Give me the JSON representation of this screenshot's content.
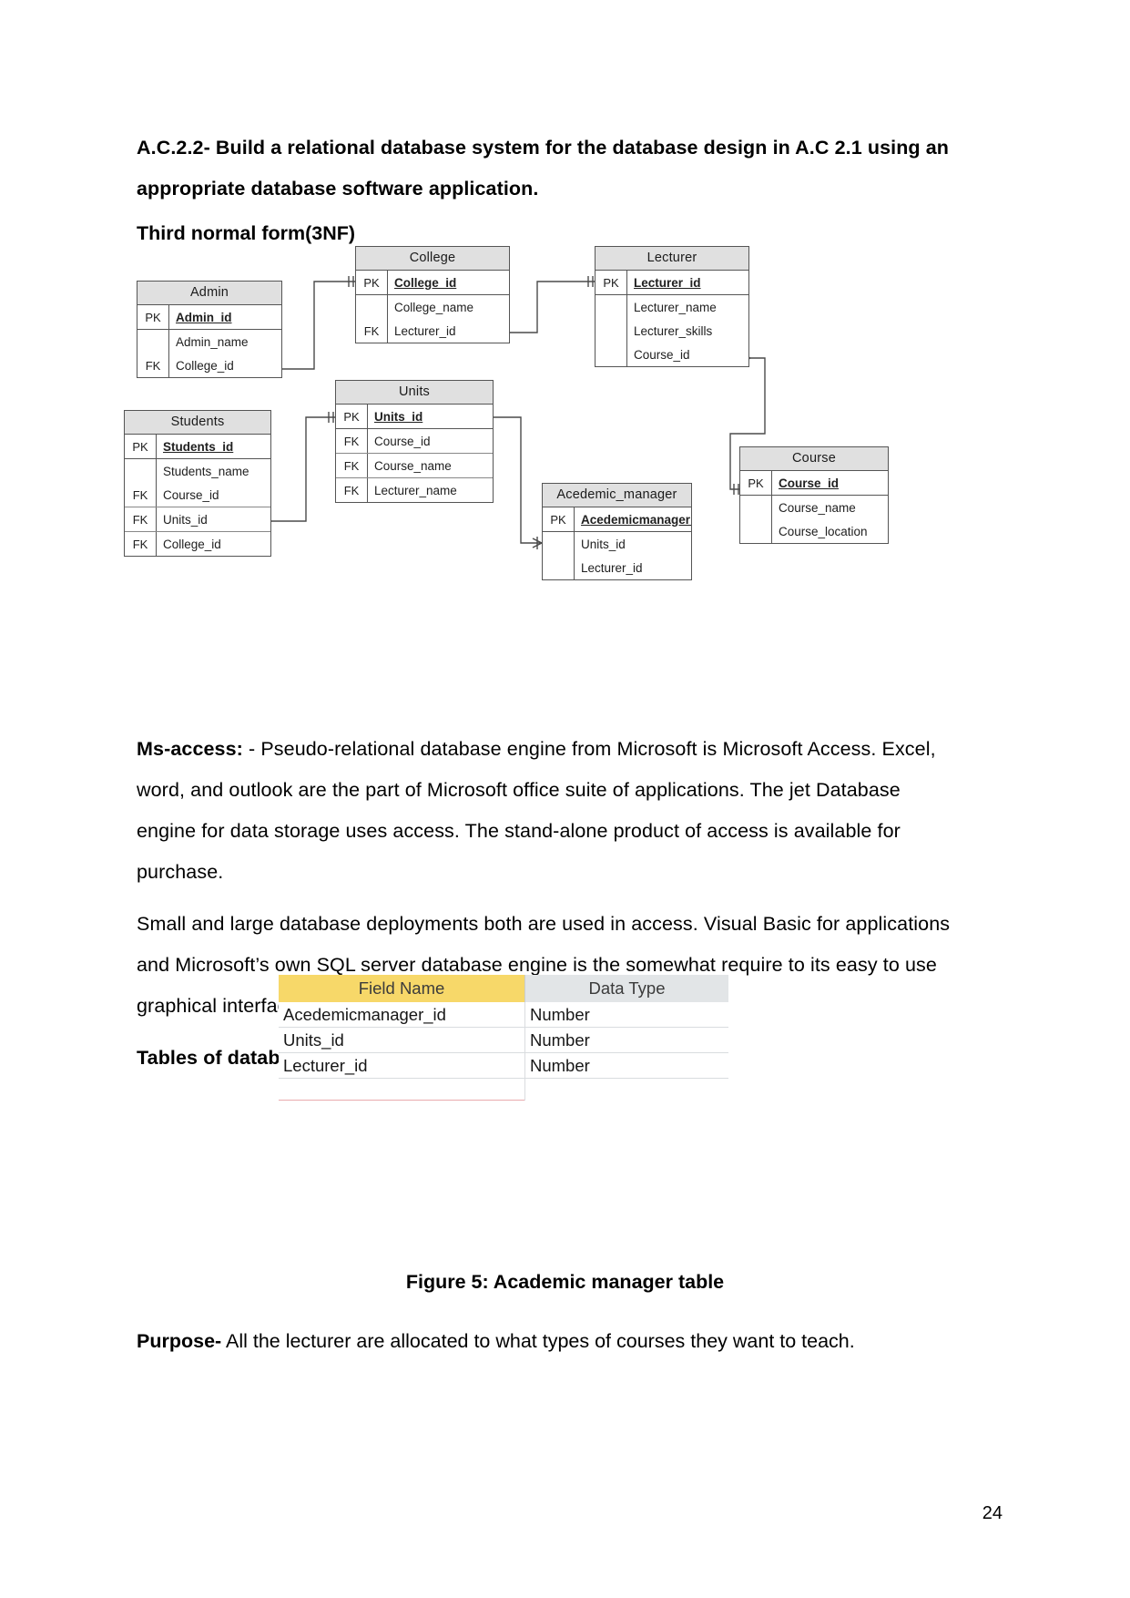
{
  "document": {
    "heading": "A.C.2.2- Build a relational database system for the database design in A.C 2.1 using an appropriate database software application.",
    "subheading": "Third normal form(3NF)",
    "page_number": "24"
  },
  "paragraphs": {
    "ms_access_lead": "Ms-access:",
    "ms_access_body": " - Pseudo-relational database engine from Microsoft is Microsoft Access. Excel, word, and outlook are the part of Microsoft office suite of applications. The jet Database engine for data storage uses access. The stand-alone product of access is available for purchase.",
    "small_large": "Small and large database deployments both are used in access. Visual Basic for applications and Microsoft’s own SQL server database engine is the somewhat require to its easy to use graphical interface, as with further applications & programme.",
    "tables_heading": "Tables of database system design",
    "purpose_lead": "Purpose-",
    "purpose_body": " All the lecturer are allocated to what types of courses they want to teach."
  },
  "figure": {
    "caption": "Figure 5: Academic manager table"
  },
  "erd": {
    "tables": [
      {
        "name": "Admin",
        "rows": [
          {
            "key": "PK",
            "field": "Admin_id"
          },
          {
            "key": "",
            "field": "Admin_name"
          },
          {
            "key": "FK",
            "field": "College_id"
          }
        ]
      },
      {
        "name": "College",
        "rows": [
          {
            "key": "PK",
            "field": "College_id"
          },
          {
            "key": "",
            "field": "College_name"
          },
          {
            "key": "FK",
            "field": "Lecturer_id"
          }
        ]
      },
      {
        "name": "Lecturer",
        "rows": [
          {
            "key": "PK",
            "field": "Lecturer_id"
          },
          {
            "key": "",
            "field": "Lecturer_name"
          },
          {
            "key": "",
            "field": "Lecturer_skills"
          },
          {
            "key": "",
            "field": "Course_id"
          }
        ]
      },
      {
        "name": "Students",
        "rows": [
          {
            "key": "PK",
            "field": "Students_id"
          },
          {
            "key": "",
            "field": "Students_name"
          },
          {
            "key": "FK",
            "field": "Course_id"
          },
          {
            "key": "FK",
            "field": "Units_id"
          },
          {
            "key": "FK",
            "field": "College_id"
          }
        ]
      },
      {
        "name": "Units",
        "rows": [
          {
            "key": "PK",
            "field": "Units_id"
          },
          {
            "key": "FK",
            "field": "Course_id"
          },
          {
            "key": "FK",
            "field": "Course_name"
          },
          {
            "key": "FK",
            "field": "Lecturer_name"
          }
        ]
      },
      {
        "name": "Acedemic_manager",
        "rows": [
          {
            "key": "PK",
            "field": "Acedemicmanager_id"
          },
          {
            "key": "",
            "field": "Units_id"
          },
          {
            "key": "",
            "field": "Lecturer_id"
          }
        ]
      },
      {
        "name": "Course",
        "rows": [
          {
            "key": "PK",
            "field": "Course_id"
          },
          {
            "key": "",
            "field": "Course_name"
          },
          {
            "key": "",
            "field": "Course_location"
          }
        ]
      }
    ]
  },
  "access_table": {
    "headers": [
      "Field Name",
      "Data Type"
    ],
    "rows": [
      {
        "field": "Acedemicmanager_id",
        "type": "Number"
      },
      {
        "field": "Units_id",
        "type": "Number"
      },
      {
        "field": "Lecturer_id",
        "type": "Number"
      }
    ],
    "header_colors": {
      "field_name": "#f7d869",
      "data_type": "#e2e5e7"
    }
  }
}
